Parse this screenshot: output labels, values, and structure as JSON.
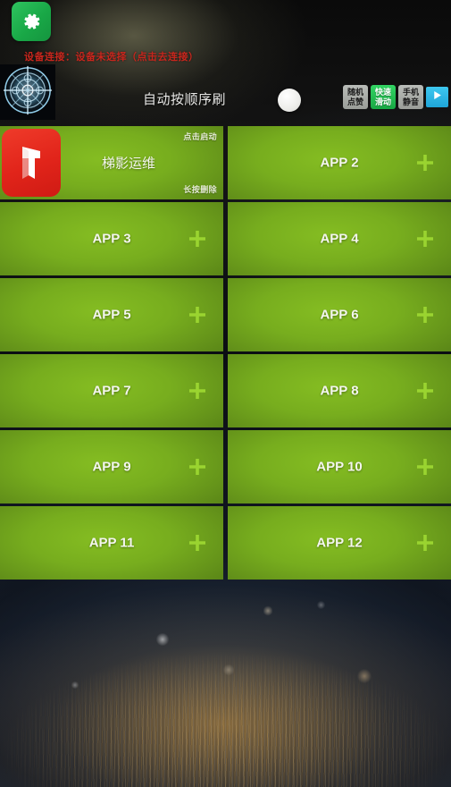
{
  "theme": {
    "card_green": "#77ad1e",
    "plus_green": "#9ad430",
    "accent_red": "#c7261d",
    "app_icon_red": "#e1241a",
    "mode_on_green": "#22b84f",
    "play_blue": "#2fb4e0"
  },
  "topbar": {
    "gear_icon": "gear-icon",
    "connection_status": "设备连接：设备未选择（点击去连接）",
    "emblem_icon": "compass-emblem-icon",
    "auto_mode_label": "自动按顺序刷",
    "toggle_state": "off",
    "mode_buttons": [
      {
        "line1": "随机",
        "line2": "点赞",
        "state": "off",
        "name": "random-like-button"
      },
      {
        "line1": "快速",
        "line2": "滑动",
        "state": "on",
        "name": "fast-swipe-button"
      },
      {
        "line1": "手机",
        "line2": "静音",
        "state": "off",
        "name": "phone-mute-button"
      }
    ],
    "play_button_label": "play-icon"
  },
  "grid": {
    "hint_tap_to_start": "点击启动",
    "hint_long_press_delete": "长按删除",
    "cards": [
      {
        "label": "梯影运维",
        "installed": true,
        "icon": "ladder-shadow-app-icon"
      },
      {
        "label": "APP 2",
        "installed": false
      },
      {
        "label": "APP 3",
        "installed": false
      },
      {
        "label": "APP 4",
        "installed": false
      },
      {
        "label": "APP 5",
        "installed": false
      },
      {
        "label": "APP 6",
        "installed": false
      },
      {
        "label": "APP 7",
        "installed": false
      },
      {
        "label": "APP 8",
        "installed": false
      },
      {
        "label": "APP 9",
        "installed": false
      },
      {
        "label": "APP 10",
        "installed": false
      },
      {
        "label": "APP 11",
        "installed": false
      },
      {
        "label": "APP 12",
        "installed": false
      }
    ]
  }
}
